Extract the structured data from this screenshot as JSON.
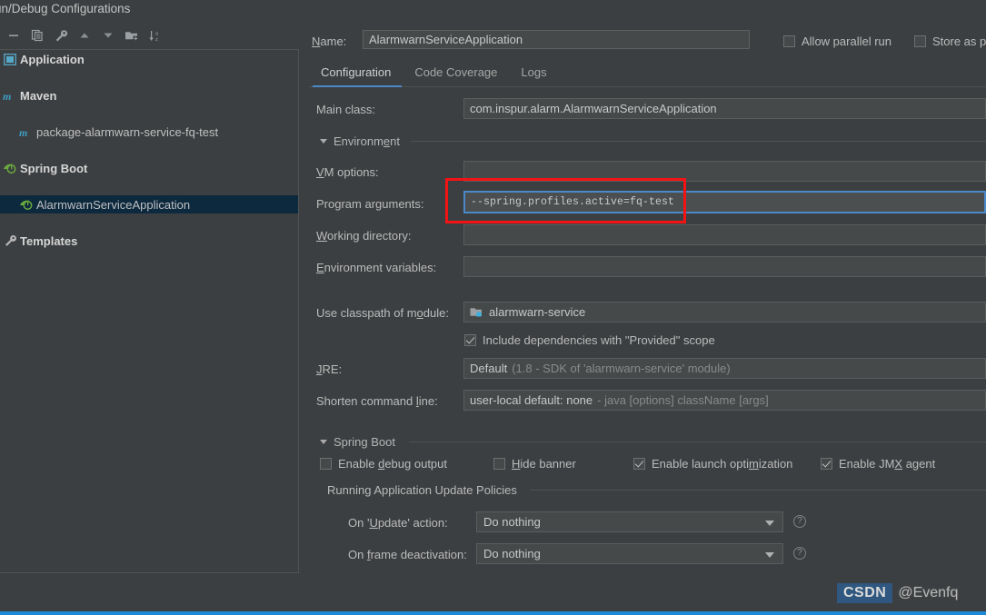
{
  "window": {
    "title": "un/Debug Configurations"
  },
  "toolbar": {
    "items": [
      {
        "name": "remove-icon",
        "glyph": "minus"
      },
      {
        "name": "copy-icon",
        "glyph": "copy"
      },
      {
        "name": "edit-templates-icon",
        "glyph": "wrench"
      },
      {
        "name": "move-up-icon",
        "glyph": "up"
      },
      {
        "name": "move-down-icon",
        "glyph": "down"
      },
      {
        "name": "move-into-folder-icon",
        "glyph": "folder-plus"
      },
      {
        "name": "sort-alphabetically-icon",
        "glyph": "sort-az"
      }
    ]
  },
  "tree": {
    "items": [
      {
        "label": "Application",
        "icon": "application-icon",
        "bold": true,
        "indent": false,
        "selected": false
      },
      {
        "label": "Maven",
        "icon": "maven-icon",
        "bold": true,
        "indent": false,
        "selected": false
      },
      {
        "label": "package-alarmwarn-service-fq-test",
        "icon": "maven-goal-icon",
        "bold": false,
        "indent": true,
        "selected": false
      },
      {
        "label": "Spring Boot",
        "icon": "spring-boot-icon",
        "bold": true,
        "indent": false,
        "selected": false
      },
      {
        "label": "AlarmwarnServiceApplication",
        "icon": "spring-boot-icon",
        "bold": false,
        "indent": true,
        "selected": true
      },
      {
        "label": "Templates",
        "icon": "templates-wrench-icon",
        "bold": true,
        "indent": false,
        "selected": false
      }
    ]
  },
  "header": {
    "name_label": "Name:",
    "name_value": "AlarmwarnServiceApplication",
    "allow_parallel_run": {
      "label": "Allow parallel run",
      "checked": false
    },
    "store_as_project_file": {
      "label": "Store as p",
      "checked": false
    }
  },
  "tabs": {
    "items": [
      {
        "label": "Configuration",
        "active": true
      },
      {
        "label": "Code Coverage",
        "active": false
      },
      {
        "label": "Logs",
        "active": false
      }
    ]
  },
  "configuration": {
    "main_class": {
      "label": "Main class:",
      "value": "com.inspur.alarm.AlarmwarnServiceApplication"
    },
    "environment_section": "Environment",
    "vm_options": {
      "label": "VM options:",
      "value": ""
    },
    "program_arguments": {
      "label": "Program arguments:",
      "value": "--spring.profiles.active=fq-test"
    },
    "working_directory": {
      "label": "Working directory:",
      "value": ""
    },
    "environment_variables": {
      "label": "Environment variables:",
      "value": ""
    },
    "use_classpath_of_module": {
      "label": "Use classpath of module:",
      "value": "alarmwarn-service"
    },
    "include_provided": {
      "label": "Include dependencies with \"Provided\" scope",
      "checked": true
    },
    "jre": {
      "label": "JRE:",
      "value": "Default",
      "hint": "(1.8 - SDK of 'alarmwarn-service' module)"
    },
    "shorten_command_line": {
      "label": "Shorten command line:",
      "value": "user-local default: none",
      "hint": "- java [options] className [args]"
    }
  },
  "spring_boot": {
    "section": "Spring Boot",
    "enable_debug_output": {
      "label": "Enable debug output",
      "checked": false
    },
    "hide_banner": {
      "label": "Hide banner",
      "checked": false
    },
    "enable_launch_optimization": {
      "label": "Enable launch optimization",
      "checked": true
    },
    "enable_jmx_agent": {
      "label": "Enable JMX agent",
      "checked": true
    },
    "update_policies_section": "Running Application Update Policies",
    "on_update_action": {
      "label": "On 'Update' action:",
      "value": "Do nothing"
    },
    "on_frame_deactivation": {
      "label": "On frame deactivation:",
      "value": "Do nothing"
    }
  },
  "annotation": {
    "highlight_color": "#f21414"
  },
  "watermark": {
    "brand": "CSDN",
    "user": "@Evenfq"
  },
  "colors": {
    "accent": "#4a88c7",
    "selection": "#0d293e",
    "background": "#3c3f41",
    "field": "#45494a",
    "bottom_bar": "#1e8ad6"
  }
}
